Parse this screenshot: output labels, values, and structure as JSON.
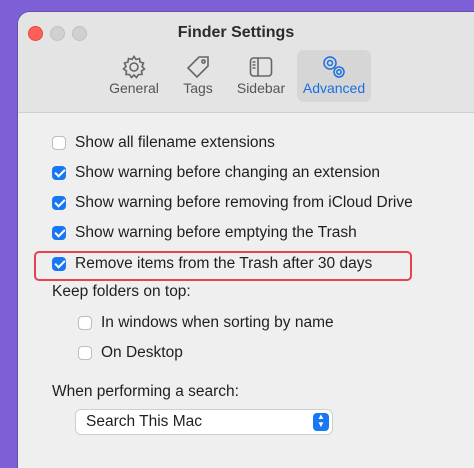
{
  "window": {
    "title": "Finder Settings"
  },
  "tabs": [
    {
      "label": "General",
      "icon": "gear-icon",
      "active": false
    },
    {
      "label": "Tags",
      "icon": "tag-icon",
      "active": false
    },
    {
      "label": "Sidebar",
      "icon": "sidebar-icon",
      "active": false
    },
    {
      "label": "Advanced",
      "icon": "gears-icon",
      "active": true
    }
  ],
  "options": [
    {
      "label": "Show all filename extensions",
      "checked": false
    },
    {
      "label": "Show warning before changing an extension",
      "checked": true
    },
    {
      "label": "Show warning before removing from iCloud Drive",
      "checked": true
    },
    {
      "label": "Show warning before emptying the Trash",
      "checked": true
    },
    {
      "label": "Remove items from the Trash after 30 days",
      "checked": true,
      "highlighted": true
    }
  ],
  "keep_folders": {
    "heading": "Keep folders on top:",
    "options": [
      {
        "label": "In windows when sorting by name",
        "checked": false
      },
      {
        "label": "On Desktop",
        "checked": false
      }
    ]
  },
  "search": {
    "heading": "When performing a search:",
    "selected": "Search This Mac"
  },
  "colors": {
    "accent": "#1877f2",
    "highlight_border": "#e8424e",
    "close_button": "#fe5f57",
    "background": "#7d5fd6"
  }
}
